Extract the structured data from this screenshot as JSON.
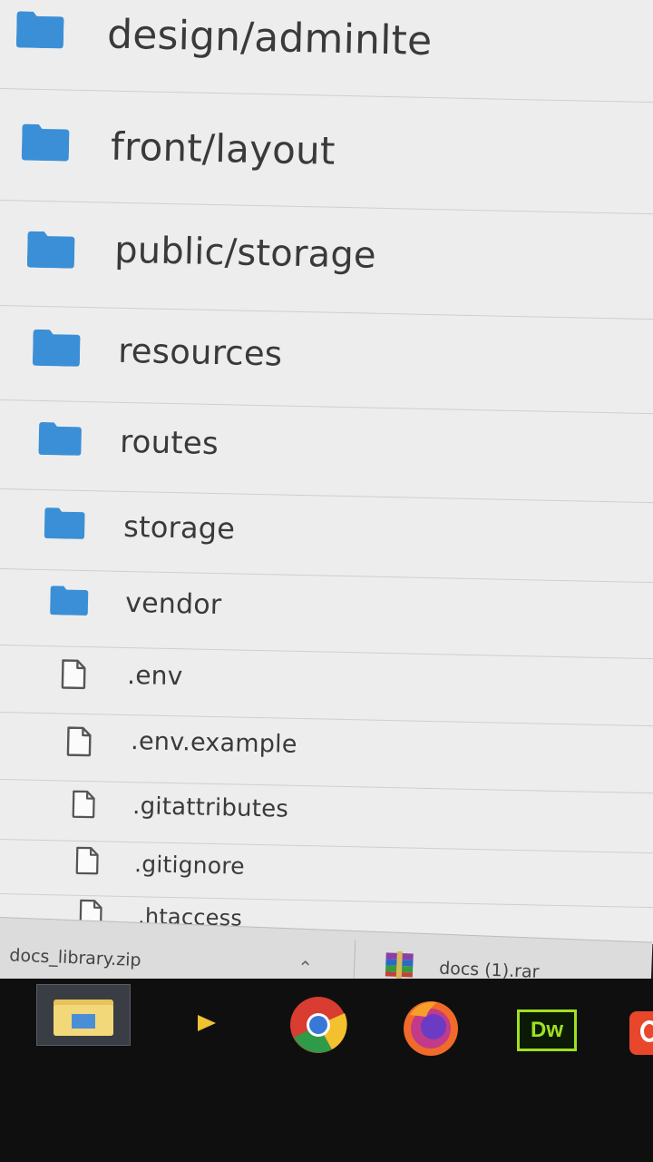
{
  "files": [
    {
      "name": "design/adminlte",
      "type": "folder"
    },
    {
      "name": "front/layout",
      "type": "folder"
    },
    {
      "name": "public/storage",
      "type": "folder"
    },
    {
      "name": "resources",
      "type": "folder"
    },
    {
      "name": "routes",
      "type": "folder"
    },
    {
      "name": "storage",
      "type": "folder"
    },
    {
      "name": "vendor",
      "type": "folder"
    },
    {
      "name": ".env",
      "type": "file"
    },
    {
      "name": ".env.example",
      "type": "file"
    },
    {
      "name": ".gitattributes",
      "type": "file"
    },
    {
      "name": ".gitignore",
      "type": "file"
    },
    {
      "name": ".htaccess",
      "type": "file"
    }
  ],
  "downloads": [
    {
      "name": "docs_library.zip",
      "icon": "chevron-up-icon"
    },
    {
      "name": "docs (1).rar",
      "icon": "winrar-icon"
    }
  ],
  "taskbar": {
    "items": [
      {
        "name": "file-explorer"
      },
      {
        "name": "media-player"
      },
      {
        "name": "chrome"
      },
      {
        "name": "firefox"
      },
      {
        "name": "dreamweaver",
        "label": "Dw"
      },
      {
        "name": "app-red"
      }
    ]
  },
  "colors": {
    "folder": "#3b8fd6",
    "list_bg": "#ededee",
    "text": "#3a3a3a",
    "taskbar": "#0f0f10",
    "dreamweaver": "#9fe021"
  }
}
